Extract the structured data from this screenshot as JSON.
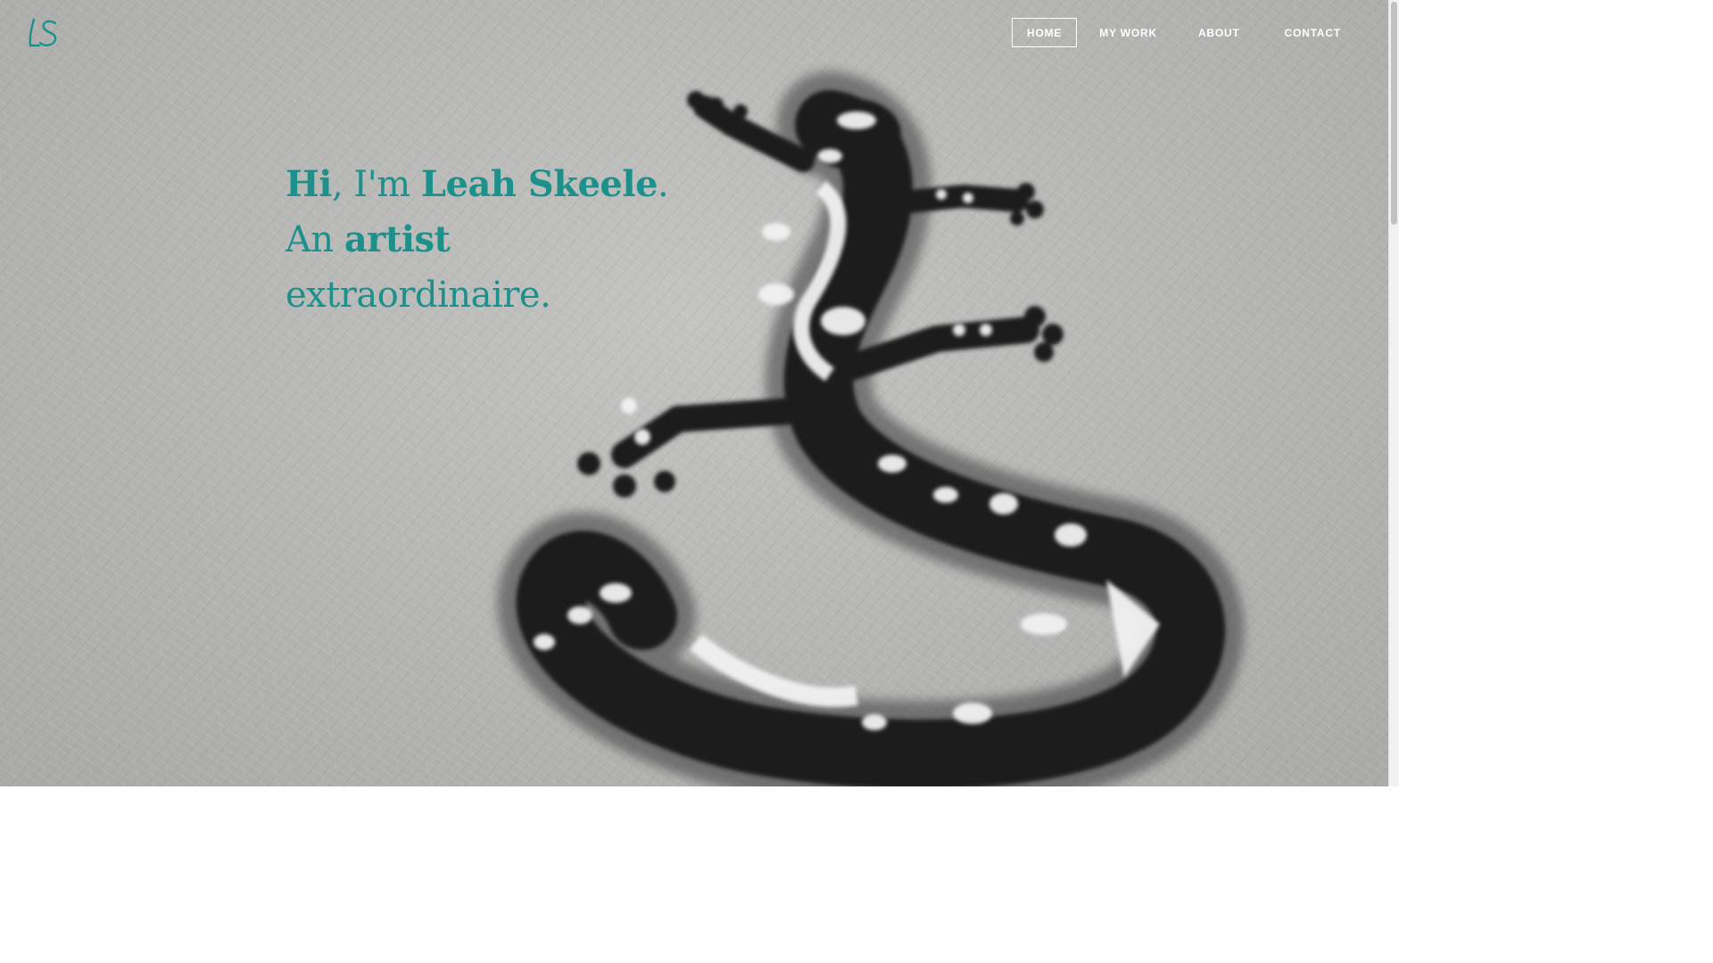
{
  "logo": {
    "text": "LS",
    "color": "#1e908b"
  },
  "nav": {
    "items": [
      {
        "label": "HOME",
        "active": true
      },
      {
        "label": "MY WORK",
        "active": false
      },
      {
        "label": "ABOUT",
        "active": false
      },
      {
        "label": "CONTACT",
        "active": false
      }
    ]
  },
  "hero": {
    "line1": {
      "hi": "Hi",
      "comma_im": ", I'm ",
      "name": "Leah Skeele",
      "period": "."
    },
    "line2": {
      "an": "An ",
      "artist": "artist"
    },
    "line3": {
      "text": "extraordinaire."
    },
    "accent_color": "#1e908b",
    "background_art": "spray-painted lizard on textured wall"
  },
  "colors": {
    "accent": "#1e908b",
    "nav_text": "#ffffff",
    "background": "#b9bab8"
  }
}
